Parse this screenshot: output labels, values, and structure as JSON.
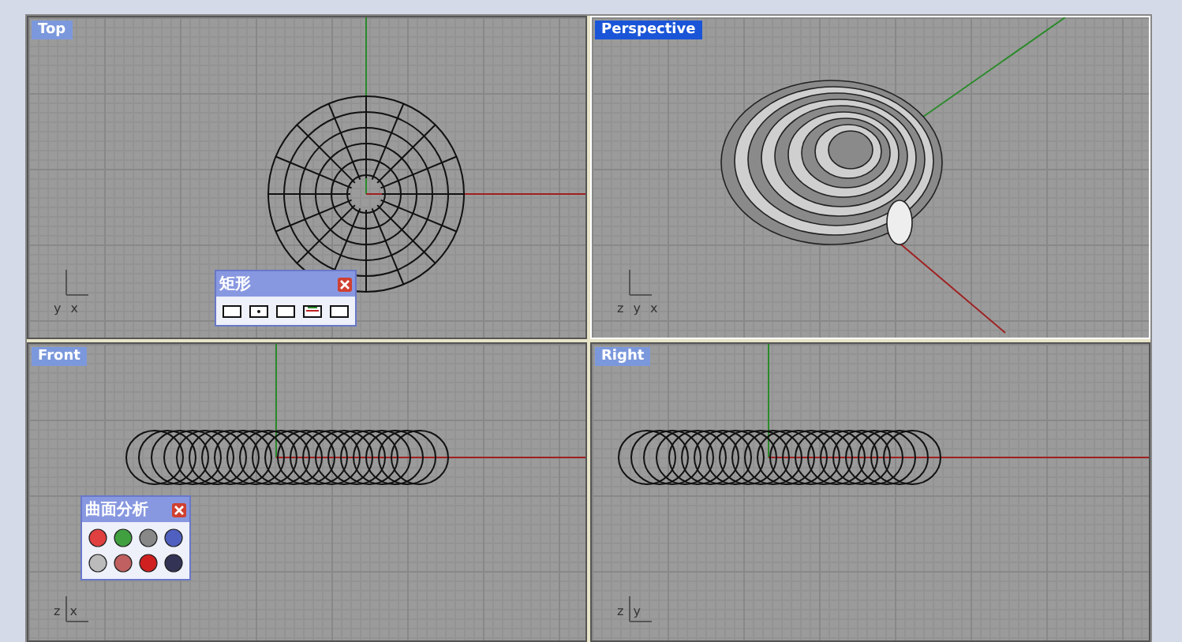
{
  "viewports": [
    {
      "title": "Top",
      "selected": false,
      "kind": "top",
      "axes": [
        "y",
        "x"
      ],
      "toolbar": {
        "title": "矩形",
        "kind": "rectangle"
      }
    },
    {
      "title": "Perspective",
      "selected": true,
      "kind": "perspective",
      "axes": [
        "z",
        "y",
        "x"
      ]
    },
    {
      "title": "Front",
      "selected": false,
      "kind": "front",
      "axes": [
        "z",
        "x"
      ],
      "toolbar": {
        "title": "曲面分析",
        "kind": "analysis"
      }
    },
    {
      "title": "Right",
      "selected": false,
      "kind": "right",
      "axes": [
        "z",
        "y"
      ]
    }
  ]
}
